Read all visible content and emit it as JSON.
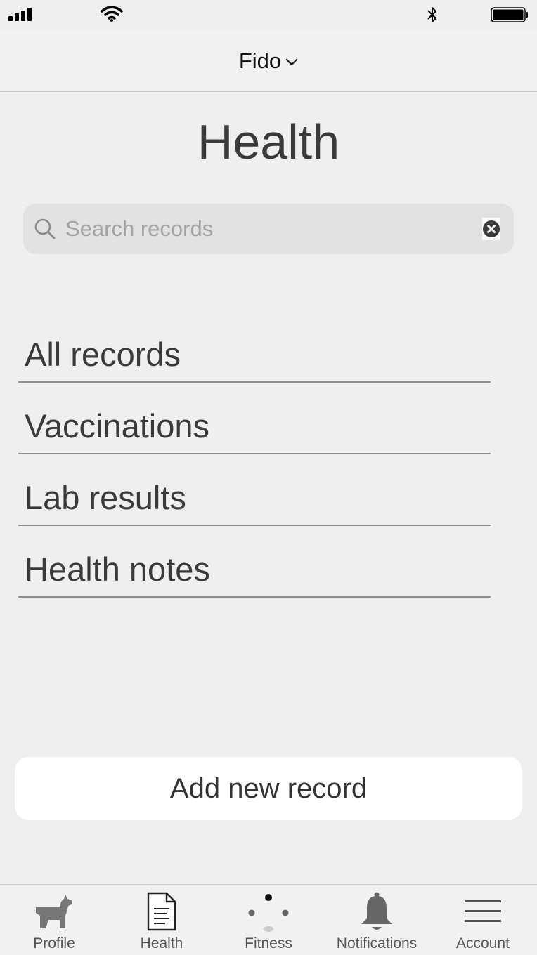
{
  "status_bar": {
    "icons": [
      "cellular-signal-icon",
      "wifi-icon",
      "bluetooth-icon",
      "battery-icon"
    ]
  },
  "header": {
    "pet_name": "Fido"
  },
  "page": {
    "title": "Health"
  },
  "search": {
    "placeholder": "Search records",
    "value": ""
  },
  "records": {
    "items": [
      {
        "label": "All records"
      },
      {
        "label": "Vaccinations"
      },
      {
        "label": "Lab results"
      },
      {
        "label": "Health notes"
      }
    ]
  },
  "actions": {
    "add_record_label": "Add new record"
  },
  "tab_bar": {
    "tabs": [
      {
        "label": "Profile",
        "icon": "dog-icon"
      },
      {
        "label": "Health",
        "icon": "document-icon"
      },
      {
        "label": "Fitness",
        "icon": "dots-icon"
      },
      {
        "label": "Notifications",
        "icon": "bell-icon"
      },
      {
        "label": "Account",
        "icon": "menu-icon"
      }
    ]
  },
  "colors": {
    "background": "#efefef",
    "search_field": "#e2e2e2",
    "button": "#ffffff",
    "text": "#333333"
  }
}
